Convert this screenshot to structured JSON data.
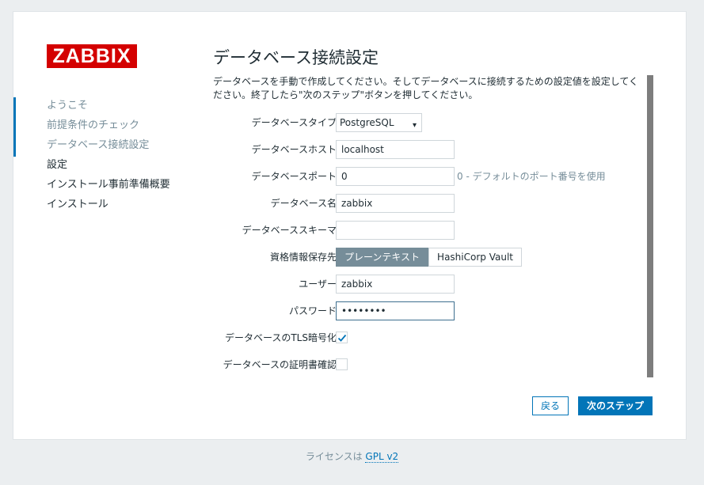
{
  "logo": {
    "text": "ZABBIX",
    "color": "#d40000"
  },
  "steps": [
    {
      "label": "ようこそ",
      "state": "done"
    },
    {
      "label": "前提条件のチェック",
      "state": "done"
    },
    {
      "label": "データベース接続設定",
      "state": "done"
    },
    {
      "label": "設定",
      "state": "pending"
    },
    {
      "label": "インストール事前準備概要",
      "state": "pending"
    },
    {
      "label": "インストール",
      "state": "pending"
    }
  ],
  "title": "データベース接続設定",
  "description": "データベースを手動で作成してください。そしてデータベースに接続するための設定値を設定してください。終了したら\"次のステップ\"ボタンを押してください。",
  "form": {
    "db_type": {
      "label": "データベースタイプ",
      "value": "PostgreSQL"
    },
    "db_host": {
      "label": "データベースホスト",
      "value": "localhost"
    },
    "db_port": {
      "label": "データベースポート",
      "value": "0",
      "hint": "0 - デフォルトのポート番号を使用"
    },
    "db_name": {
      "label": "データベース名",
      "value": "zabbix"
    },
    "db_schema": {
      "label": "データベーススキーマ",
      "value": ""
    },
    "cred_store": {
      "label": "資格情報保存先",
      "options": [
        "プレーンテキスト",
        "HashiCorp Vault"
      ],
      "selected": "プレーンテキスト"
    },
    "user": {
      "label": "ユーザー",
      "value": "zabbix"
    },
    "password": {
      "label": "パスワード",
      "value": "••••••••"
    },
    "tls": {
      "label": "データベースのTLS暗号化",
      "checked": true
    },
    "cert_verify": {
      "label": "データベースの証明書確認",
      "checked": false
    }
  },
  "buttons": {
    "back": "戻る",
    "next": "次のステップ"
  },
  "footer": {
    "text": "ライセンスは",
    "link": "GPL v2"
  },
  "colors": {
    "accent": "#0275b8",
    "muted": "#768d99",
    "active_segment": "#768d99"
  }
}
